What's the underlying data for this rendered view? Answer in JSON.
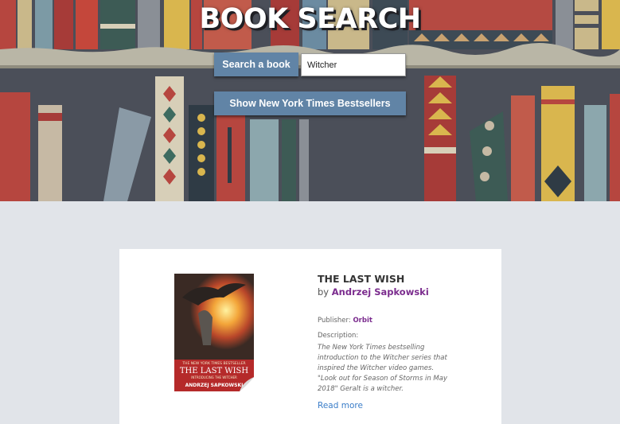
{
  "header": {
    "title": "BOOK SEARCH",
    "search_button_label": "Search a book",
    "search_value": "Witcher",
    "nyt_button_label": "Show New York Times Bestsellers"
  },
  "result": {
    "title": "THE LAST WISH",
    "by_prefix": "by",
    "author": "Andrzej Sapkowski",
    "publisher_label": "Publisher:",
    "publisher": "Orbit",
    "description_label": "Description:",
    "description": "The New York Times bestselling introduction to the Witcher series that inspired the Witcher video games. \"Look out for Season of Storms in May 2018\" Geralt is a witcher.",
    "read_more": "Read more",
    "cover": {
      "top_text": "THE NEW YORK TIMES BESTSELLER",
      "title": "THE LAST WISH",
      "subtitle": "INTRODUCING THE WITCHER",
      "author": "ANDRZEJ SAPKOWSKI"
    }
  },
  "colors": {
    "accent_button": "#6184a6",
    "link_purple": "#7b2c8e",
    "read_more_blue": "#3a7dc8",
    "page_bg": "#e1e4e9"
  }
}
